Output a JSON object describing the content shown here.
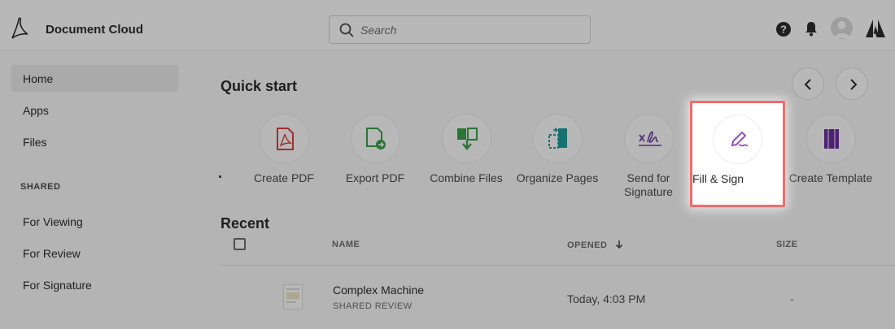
{
  "header": {
    "brand": "Document Cloud",
    "search_placeholder": "Search",
    "icons": [
      "acrobat-logo-icon",
      "search-icon",
      "help-icon",
      "bell-icon",
      "avatar",
      "adobe-logo-icon"
    ]
  },
  "sidebar": {
    "items": [
      {
        "label": "Home",
        "active": true
      },
      {
        "label": "Apps"
      },
      {
        "label": "Files"
      }
    ],
    "shared_heading": "SHARED",
    "shared_items": [
      {
        "label": "For Viewing"
      },
      {
        "label": "For Review"
      },
      {
        "label": "For Signature"
      }
    ]
  },
  "quick_start": {
    "title": "Quick start",
    "tools": [
      {
        "label": "Create PDF",
        "icon": "create-pdf-icon",
        "color": "#e03e3e"
      },
      {
        "label": "Export PDF",
        "icon": "export-pdf-icon",
        "color": "#3aa34a"
      },
      {
        "label": "Combine Files",
        "icon": "combine-files-icon",
        "color": "#3aa34a"
      },
      {
        "label": "Organize Pages",
        "icon": "organize-pages-icon",
        "color": "#1f9f9f"
      },
      {
        "label": "Send for Signature",
        "icon": "send-signature-icon",
        "color": "#6b3fa0"
      },
      {
        "label": "Fill & Sign",
        "icon": "fill-sign-icon",
        "color": "#8b3fc5",
        "highlighted": true
      },
      {
        "label": "Create Template",
        "icon": "create-template-icon",
        "color": "#6b2fa0"
      }
    ]
  },
  "recent": {
    "title": "Recent",
    "columns": {
      "name": "NAME",
      "opened": "OPENED",
      "size": "SIZE"
    },
    "rows": [
      {
        "name": "Complex Machine",
        "sub": "SHARED REVIEW",
        "opened": "Today, 4:03 PM",
        "size": "-"
      }
    ]
  },
  "colors": {
    "highlight": "#f26b6b",
    "accent": "#8b3fc5"
  }
}
